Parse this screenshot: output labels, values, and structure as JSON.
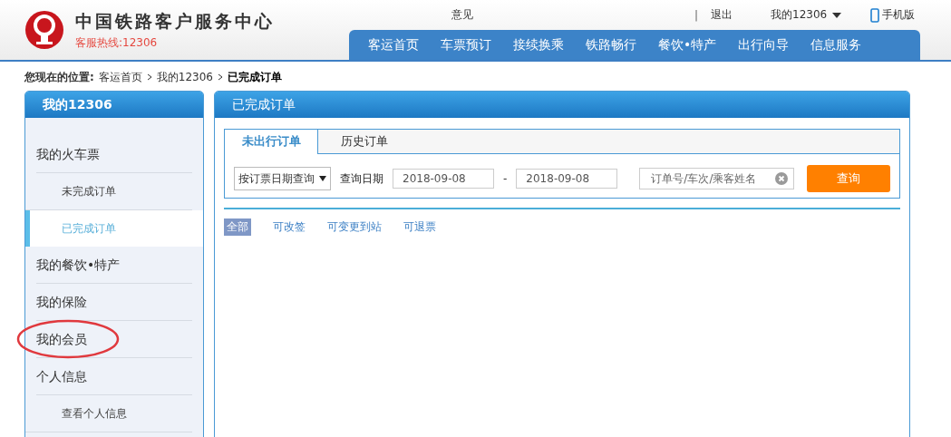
{
  "header": {
    "site_title": "中国铁路客户服务中心",
    "hotline": "客服热线:12306",
    "top_links": [
      {
        "kind": "text",
        "label": "意见"
      },
      {
        "kind": "separator",
        "label": "|"
      },
      {
        "kind": "text",
        "label": "退出"
      },
      {
        "kind": "dropdown",
        "label": "我的12306"
      },
      {
        "kind": "mobile",
        "label": "手机版"
      }
    ],
    "nav": [
      {
        "label": "客运首页",
        "selected": false
      },
      {
        "label": "车票预订",
        "selected": false
      },
      {
        "label": "接续换乘",
        "selected": false
      },
      {
        "label": "铁路畅行",
        "selected": false
      },
      {
        "label": "餐饮•特产",
        "selected": false
      },
      {
        "label": "出行向导",
        "selected": false
      },
      {
        "label": "信息服务",
        "selected": false
      }
    ]
  },
  "breadcrumb": {
    "label": "您现在的位置:",
    "items": [
      {
        "label": "客运首页",
        "current": false
      },
      {
        "label": "我的12306",
        "current": false
      },
      {
        "label": "已完成订单",
        "current": true
      }
    ]
  },
  "sidebar": {
    "title": "我的12306",
    "items": [
      {
        "label": "我的火车票",
        "selected": false,
        "annotated": false,
        "children": [
          {
            "label": "未完成订单",
            "selected": false
          },
          {
            "label": "已完成订单",
            "selected": true
          }
        ]
      },
      {
        "label": "我的餐饮•特产",
        "selected": false,
        "annotated": false
      },
      {
        "label": "我的保险",
        "selected": false,
        "annotated": false
      },
      {
        "label": "我的会员",
        "selected": false,
        "annotated": true
      },
      {
        "label": "个人信息",
        "selected": false,
        "annotated": false,
        "children": [
          {
            "label": "查看个人信息",
            "selected": false
          }
        ]
      }
    ]
  },
  "panel": {
    "title": "已完成订单",
    "tabs": [
      {
        "label": "未出行订单",
        "selected": true
      },
      {
        "label": "历史订单",
        "selected": false
      }
    ],
    "query_type": "按订票日期查询",
    "date_label": "查询日期",
    "date_from": "2018-09-08",
    "date_sep": "-",
    "date_to": "2018-09-08",
    "keyword_placeholder": "订单号/车次/乘客姓名",
    "search_button": "查询",
    "filters": [
      {
        "label": "全部",
        "selected": true
      },
      {
        "label": "可改签",
        "selected": false
      },
      {
        "label": "可变更到站",
        "selected": false
      },
      {
        "label": "可退票",
        "selected": false
      }
    ]
  }
}
